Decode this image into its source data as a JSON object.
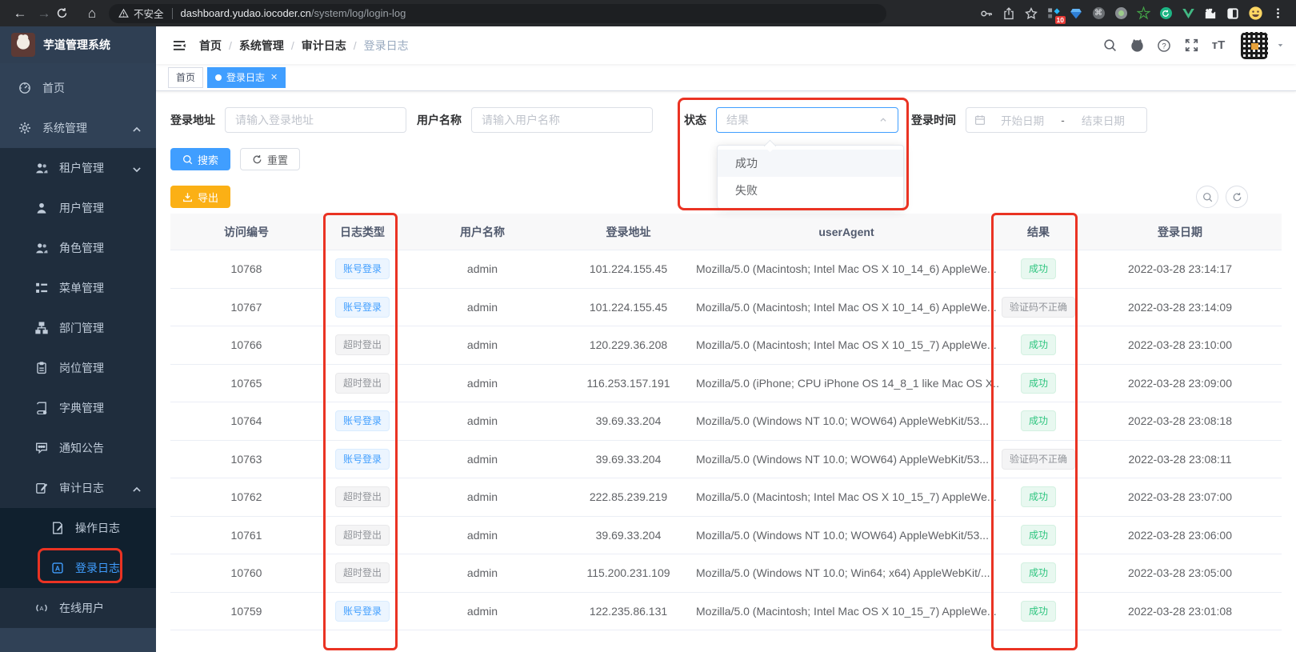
{
  "browser": {
    "security_label": "不安全",
    "url_host": "dashboard.yudao.iocoder.cn",
    "url_path": "/system/log/login-log",
    "extension_badge": "10"
  },
  "sidebar": {
    "app_title": "芋道管理系统",
    "items": [
      {
        "id": "home",
        "label": "首页",
        "icon": "dashboard-icon",
        "level": 1
      },
      {
        "id": "system-management",
        "label": "系统管理",
        "icon": "gear-icon",
        "level": 1,
        "caret": "up"
      },
      {
        "id": "tenant-management",
        "label": "租户管理",
        "icon": "users-icon",
        "level": 2,
        "caret": "down"
      },
      {
        "id": "user-management",
        "label": "用户管理",
        "icon": "user-icon",
        "level": 2
      },
      {
        "id": "role-management",
        "label": "角色管理",
        "icon": "users-icon",
        "level": 2
      },
      {
        "id": "menu-management",
        "label": "菜单管理",
        "icon": "menu-tree-icon",
        "level": 2
      },
      {
        "id": "department-management",
        "label": "部门管理",
        "icon": "org-chart-icon",
        "level": 2
      },
      {
        "id": "post-management",
        "label": "岗位管理",
        "icon": "badge-icon",
        "level": 2
      },
      {
        "id": "dict-management",
        "label": "字典管理",
        "icon": "dictionary-icon",
        "level": 2
      },
      {
        "id": "notice-announcement",
        "label": "通知公告",
        "icon": "announcement-icon",
        "level": 2
      },
      {
        "id": "audit-log",
        "label": "审计日志",
        "icon": "audit-log-icon",
        "level": 2,
        "caret": "up"
      },
      {
        "id": "operation-log",
        "label": "操作日志",
        "icon": "operation-log-icon",
        "level": 3
      },
      {
        "id": "login-log",
        "label": "登录日志",
        "icon": "login-log-icon",
        "level": 3,
        "active": true
      },
      {
        "id": "online-users",
        "label": "在线用户",
        "icon": "online-users-icon",
        "level": 2
      }
    ]
  },
  "header": {
    "breadcrumb": [
      "首页",
      "系统管理",
      "审计日志",
      "登录日志"
    ]
  },
  "tabs": [
    {
      "label": "首页",
      "active": false
    },
    {
      "label": "登录日志",
      "active": true,
      "closable": true
    }
  ],
  "filters": {
    "login_address_label": "登录地址",
    "login_address_placeholder": "请输入登录地址",
    "username_label": "用户名称",
    "username_placeholder": "请输入用户名称",
    "status_label": "状态",
    "status_placeholder": "结果",
    "status_options": [
      {
        "label": "成功",
        "hovered": true
      },
      {
        "label": "失败",
        "hovered": false
      }
    ],
    "login_time_label": "登录时间",
    "date_start_placeholder": "开始日期",
    "date_separator": "-",
    "date_end_placeholder": "结束日期",
    "search_label": "搜索",
    "reset_label": "重置",
    "export_label": "导出"
  },
  "table": {
    "columns": [
      "访问编号",
      "日志类型",
      "用户名称",
      "登录地址",
      "userAgent",
      "结果",
      "登录日期"
    ],
    "rows": [
      {
        "id": "10768",
        "log_type": "账号登录",
        "log_type_style": "blue",
        "username": "admin",
        "address": "101.224.155.45",
        "user_agent": "Mozilla/5.0 (Macintosh; Intel Mac OS X 10_14_6) AppleWe...",
        "result": "成功",
        "result_style": "green",
        "date": "2022-03-28 23:14:17"
      },
      {
        "id": "10767",
        "log_type": "账号登录",
        "log_type_style": "blue",
        "username": "admin",
        "address": "101.224.155.45",
        "user_agent": "Mozilla/5.0 (Macintosh; Intel Mac OS X 10_14_6) AppleWe...",
        "result": "验证码不正确",
        "result_style": "gray",
        "date": "2022-03-28 23:14:09"
      },
      {
        "id": "10766",
        "log_type": "超时登出",
        "log_type_style": "gray",
        "username": "admin",
        "address": "120.229.36.208",
        "user_agent": "Mozilla/5.0 (Macintosh; Intel Mac OS X 10_15_7) AppleWe...",
        "result": "成功",
        "result_style": "green",
        "date": "2022-03-28 23:10:00"
      },
      {
        "id": "10765",
        "log_type": "超时登出",
        "log_type_style": "gray",
        "username": "admin",
        "address": "116.253.157.191",
        "user_agent": "Mozilla/5.0 (iPhone; CPU iPhone OS 14_8_1 like Mac OS X...",
        "result": "成功",
        "result_style": "green",
        "date": "2022-03-28 23:09:00"
      },
      {
        "id": "10764",
        "log_type": "账号登录",
        "log_type_style": "blue",
        "username": "admin",
        "address": "39.69.33.204",
        "user_agent": "Mozilla/5.0 (Windows NT 10.0; WOW64) AppleWebKit/53...",
        "result": "成功",
        "result_style": "green",
        "date": "2022-03-28 23:08:18"
      },
      {
        "id": "10763",
        "log_type": "账号登录",
        "log_type_style": "blue",
        "username": "admin",
        "address": "39.69.33.204",
        "user_agent": "Mozilla/5.0 (Windows NT 10.0; WOW64) AppleWebKit/53...",
        "result": "验证码不正确",
        "result_style": "gray",
        "date": "2022-03-28 23:08:11"
      },
      {
        "id": "10762",
        "log_type": "超时登出",
        "log_type_style": "gray",
        "username": "admin",
        "address": "222.85.239.219",
        "user_agent": "Mozilla/5.0 (Macintosh; Intel Mac OS X 10_15_7) AppleWe...",
        "result": "成功",
        "result_style": "green",
        "date": "2022-03-28 23:07:00"
      },
      {
        "id": "10761",
        "log_type": "超时登出",
        "log_type_style": "gray",
        "username": "admin",
        "address": "39.69.33.204",
        "user_agent": "Mozilla/5.0 (Windows NT 10.0; WOW64) AppleWebKit/53...",
        "result": "成功",
        "result_style": "green",
        "date": "2022-03-28 23:06:00"
      },
      {
        "id": "10760",
        "log_type": "超时登出",
        "log_type_style": "gray",
        "username": "admin",
        "address": "115.200.231.109",
        "user_agent": "Mozilla/5.0 (Windows NT 10.0; Win64; x64) AppleWebKit/...",
        "result": "成功",
        "result_style": "green",
        "date": "2022-03-28 23:05:00"
      },
      {
        "id": "10759",
        "log_type": "账号登录",
        "log_type_style": "blue",
        "username": "admin",
        "address": "122.235.86.131",
        "user_agent": "Mozilla/5.0 (Macintosh; Intel Mac OS X 10_15_7) AppleWe...",
        "result": "成功",
        "result_style": "green",
        "date": "2022-03-28 23:01:08"
      }
    ]
  },
  "colors": {
    "accent_blue": "#409eff",
    "annotation_red": "#ea3323",
    "export_yellow": "#fbb015",
    "success_green": "#2ec57f",
    "sidebar_bg": "#304156",
    "submenu_bg": "#1f2d3d"
  }
}
